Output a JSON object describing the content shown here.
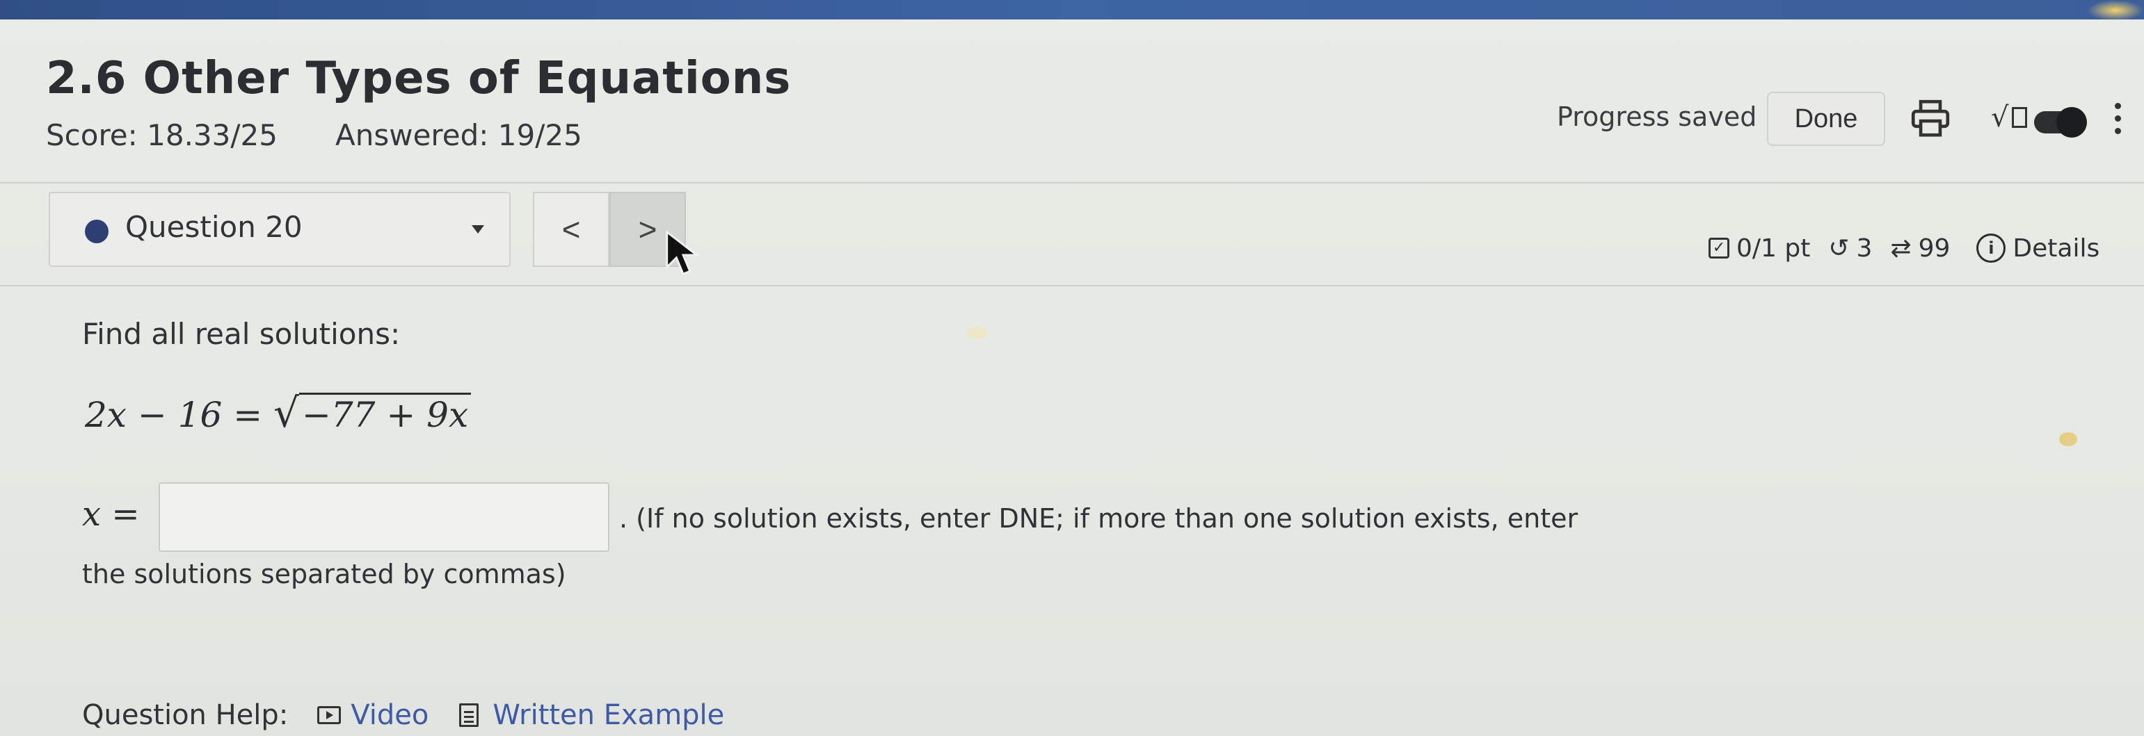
{
  "header": {
    "title": "2.6 Other Types of Equations",
    "score": "Score: 18.33/25",
    "answered": "Answered: 19/25",
    "progress_saved": "Progress saved",
    "done_label": "Done"
  },
  "question_nav": {
    "selected_question": "Question 20",
    "prev_symbol": "<",
    "next_symbol": ">"
  },
  "question_meta": {
    "points": "0/1 pt",
    "retries": "3",
    "attempts": "99",
    "details_label": "Details"
  },
  "question": {
    "prompt": "Find all real solutions:",
    "equation_lhs": "2x − 16 = ",
    "equation_radicand": "−77 + 9x",
    "answer_lhs": "x =",
    "answer_value": "",
    "instructions_line1": ". (If no solution exists, enter DNE; if more than one solution exists, enter",
    "instructions_line2": "the solutions separated by commas)"
  },
  "help": {
    "label": "Question Help:",
    "video_label": "Video",
    "written_example_label": "Written Example"
  },
  "icons": {
    "print": "print-icon",
    "sqrt": "sqrt-icon",
    "toggle": "toggle-icon",
    "more": "more-vert-icon",
    "retry": "retry-icon",
    "attempts": "repeat-icon",
    "info": "info-icon",
    "video": "video-icon",
    "document": "document-icon"
  },
  "colors": {
    "accent": "#2d3f72",
    "link": "#3d5aa8",
    "top_bar": "#3d64a3"
  }
}
